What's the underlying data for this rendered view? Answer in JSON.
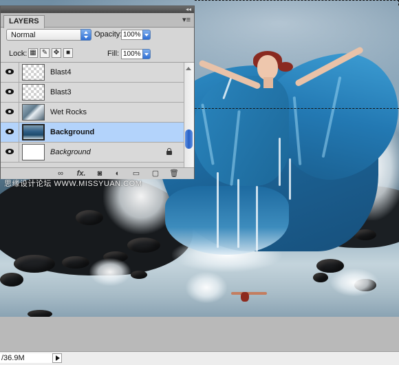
{
  "layers_panel": {
    "tab_label": "LAYERS",
    "blend_mode": "Normal",
    "opacity_label": "Opacity:",
    "opacity_value": "100%",
    "lock_label": "Lock:",
    "fill_label": "Fill:",
    "fill_value": "100%",
    "layers": [
      {
        "name": "Blast4",
        "thumbnail": "transparent",
        "visible": true,
        "selected": false
      },
      {
        "name": "Blast3",
        "thumbnail": "transparent",
        "visible": true,
        "selected": false
      },
      {
        "name": "Wet Rocks",
        "thumbnail": "rocks",
        "visible": true,
        "selected": false
      },
      {
        "name": "Background",
        "thumbnail": "photo",
        "visible": true,
        "selected": true
      },
      {
        "name": "Background",
        "thumbnail": "white",
        "visible": true,
        "selected": false,
        "locked": true
      }
    ],
    "footer_icons": [
      "link-layers-icon",
      "fx-icon",
      "layer-mask-icon",
      "adjustment-layer-icon",
      "new-group-icon",
      "new-layer-icon",
      "trash-icon"
    ],
    "fx_label": "fx."
  },
  "watermark": "思缘设计论坛 WWW.MISSYUAN.COM",
  "status": {
    "doc_size": "/36.9M"
  },
  "colors": {
    "selection_highlight": "#b3d3fb",
    "aqua_blue": "#2f6fd4",
    "panel_gray": "#d6d6d6"
  }
}
